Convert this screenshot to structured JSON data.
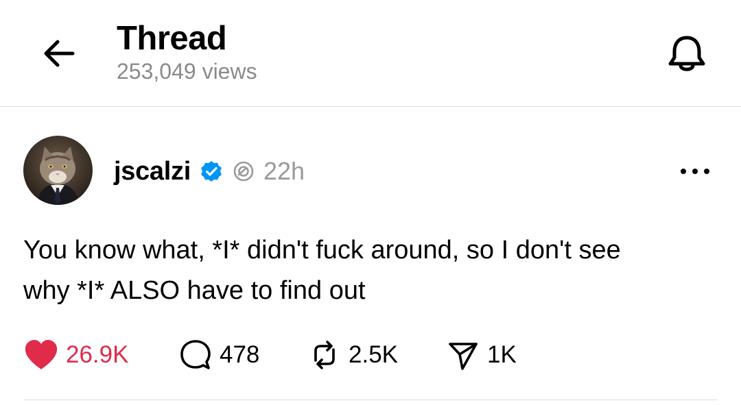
{
  "header": {
    "title": "Thread",
    "views": "253,049 views"
  },
  "post": {
    "username": "jscalzi",
    "time": "22h",
    "text_line1": "You know what, *I* didn't fuck around, so I don't see",
    "text_line2": "why *I* ALSO have to find out"
  },
  "actions": {
    "likes": "26.9K",
    "replies": "478",
    "reposts": "2.5K",
    "shares": "1K"
  },
  "colors": {
    "like": "#e02b4b",
    "verified": "#0095f6",
    "muted": "#8a8a8a"
  },
  "icons": [
    "back-arrow-icon",
    "bell-icon",
    "verified-badge-icon",
    "threads-icon",
    "more-icon",
    "heart-icon",
    "reply-icon",
    "repost-icon",
    "share-icon"
  ]
}
